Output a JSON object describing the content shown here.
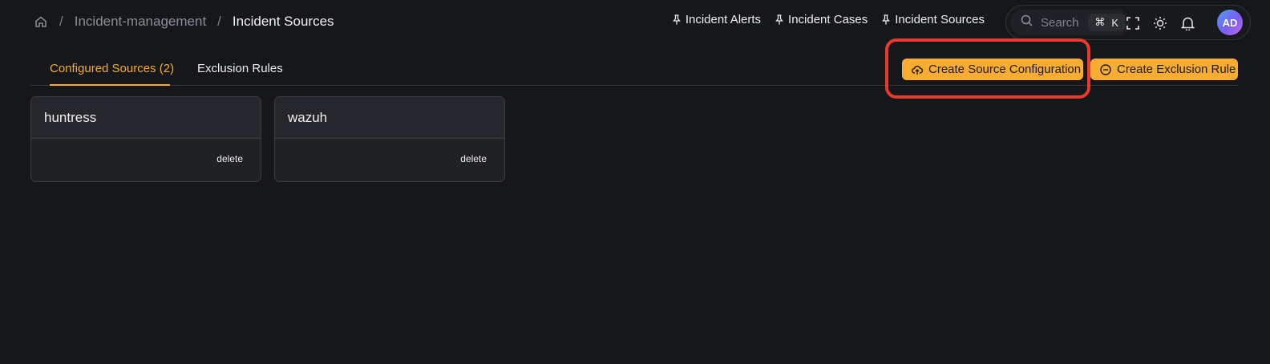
{
  "breadcrumb": {
    "home_icon": "home-icon",
    "items": [
      "Incident-management",
      "Incident Sources"
    ],
    "separator": "/"
  },
  "pinned_links": [
    {
      "label": "Incident Alerts",
      "icon": "pin-icon"
    },
    {
      "label": "Incident Cases",
      "icon": "pin-icon"
    },
    {
      "label": "Incident Sources",
      "icon": "pin-icon"
    }
  ],
  "search": {
    "placeholder": "Search",
    "shortcut_symbol": "⌘",
    "shortcut_key": "K"
  },
  "toolbar_icons": [
    "fullscreen-icon",
    "sun-icon",
    "bell-icon"
  ],
  "avatar": {
    "initials": "AD"
  },
  "tabs": [
    {
      "label": "Configured Sources (2)",
      "active": true
    },
    {
      "label": "Exclusion Rules",
      "active": false
    }
  ],
  "actions": {
    "create_source": "Create Source Configuration",
    "create_exclusion": "Create Exclusion Rule"
  },
  "sources": [
    {
      "name": "huntress",
      "action": "delete"
    },
    {
      "name": "wazuh",
      "action": "delete"
    }
  ],
  "colors": {
    "background": "#16171b",
    "accent": "#f8ac31",
    "highlight": "#e83a2f"
  }
}
